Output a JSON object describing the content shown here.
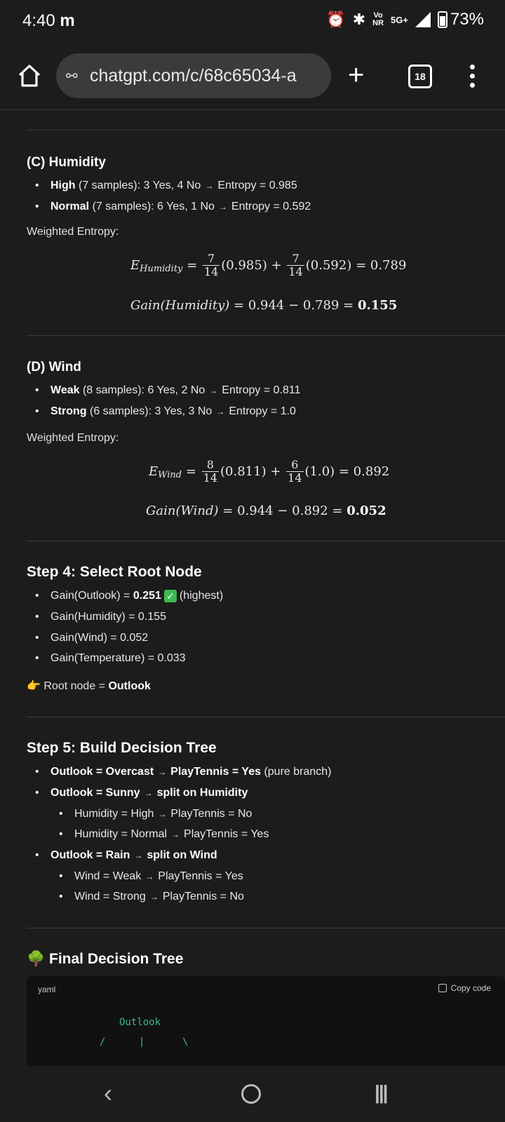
{
  "status": {
    "time": "4:40",
    "carrier_icon": "m",
    "net_top": "Vo",
    "net_bottom": "NR",
    "signal_type": "5G+",
    "battery": "73%"
  },
  "browser": {
    "url": "chatgpt.com/c/68c65034-a",
    "tab_count": "18"
  },
  "humidity": {
    "heading": "(C) Humidity",
    "items": [
      {
        "label": "High",
        "rest": "(7 samples): 3 Yes, 4 No",
        "arrow": "→",
        "entropy": "Entropy = 0.985"
      },
      {
        "label": "Normal",
        "rest": "(7 samples): 6 Yes, 1 No",
        "arrow": "→",
        "entropy": "Entropy = 0.592"
      }
    ],
    "weighted_label": "Weighted Entropy:",
    "eq1": {
      "lhs": "E",
      "sub": "Humidity",
      "n1": "7",
      "d1": "14",
      "v1": "(0.985) +",
      "n2": "7",
      "d2": "14",
      "v2": "(0.592) = 0.789"
    },
    "eq2": {
      "lhs": "Gain(Humidity)",
      "mid": "= 0.944 − 0.789 =",
      "result": "0.155"
    }
  },
  "wind": {
    "heading": "(D) Wind",
    "items": [
      {
        "label": "Weak",
        "rest": "(8 samples): 6 Yes, 2 No",
        "arrow": "→",
        "entropy": "Entropy = 0.811"
      },
      {
        "label": "Strong",
        "rest": "(6 samples): 3 Yes, 3 No",
        "arrow": "→",
        "entropy": "Entropy = 1.0"
      }
    ],
    "weighted_label": "Weighted Entropy:",
    "eq1": {
      "lhs": "E",
      "sub": "Wind",
      "n1": "8",
      "d1": "14",
      "v1": "(0.811) +",
      "n2": "6",
      "d2": "14",
      "v2": "(1.0) = 0.892"
    },
    "eq2": {
      "lhs": "Gain(Wind)",
      "mid": "= 0.944 − 0.892 =",
      "result": "0.052"
    }
  },
  "step4": {
    "heading": "Step 4: Select Root Node",
    "g1_pre": "Gain(Outlook) =",
    "g1_val": "0.251",
    "g1_post": "(highest)",
    "g2": "Gain(Humidity) = 0.155",
    "g3": "Gain(Wind) = 0.052",
    "g4": "Gain(Temperature) = 0.033",
    "root_icon": "👉",
    "root_pre": "Root node =",
    "root_val": "Outlook"
  },
  "step5": {
    "heading": "Step 5: Build Decision Tree",
    "b1_a": "Outlook = Overcast",
    "b1_b": "PlayTennis = Yes",
    "b1_c": "(pure branch)",
    "b2_a": "Outlook = Sunny",
    "b2_b": "split on Humidity",
    "b2_s1_a": "Humidity = High",
    "b2_s1_b": "PlayTennis = No",
    "b2_s2_a": "Humidity = Normal",
    "b2_s2_b": "PlayTennis = Yes",
    "b3_a": "Outlook = Rain",
    "b3_b": "split on Wind",
    "b3_s1_a": "Wind = Weak",
    "b3_s1_b": "PlayTennis = Yes",
    "b3_s2_a": "Wind = Strong",
    "b3_s2_b": "PlayTennis = No",
    "arrow": "→"
  },
  "final": {
    "icon": "🌳",
    "heading": "Final Decision Tree",
    "lang": "yaml",
    "copy": "Copy code",
    "code_line": "Outlook",
    "branch_left": "/",
    "branch_mid": "|",
    "branch_right": "\\"
  }
}
